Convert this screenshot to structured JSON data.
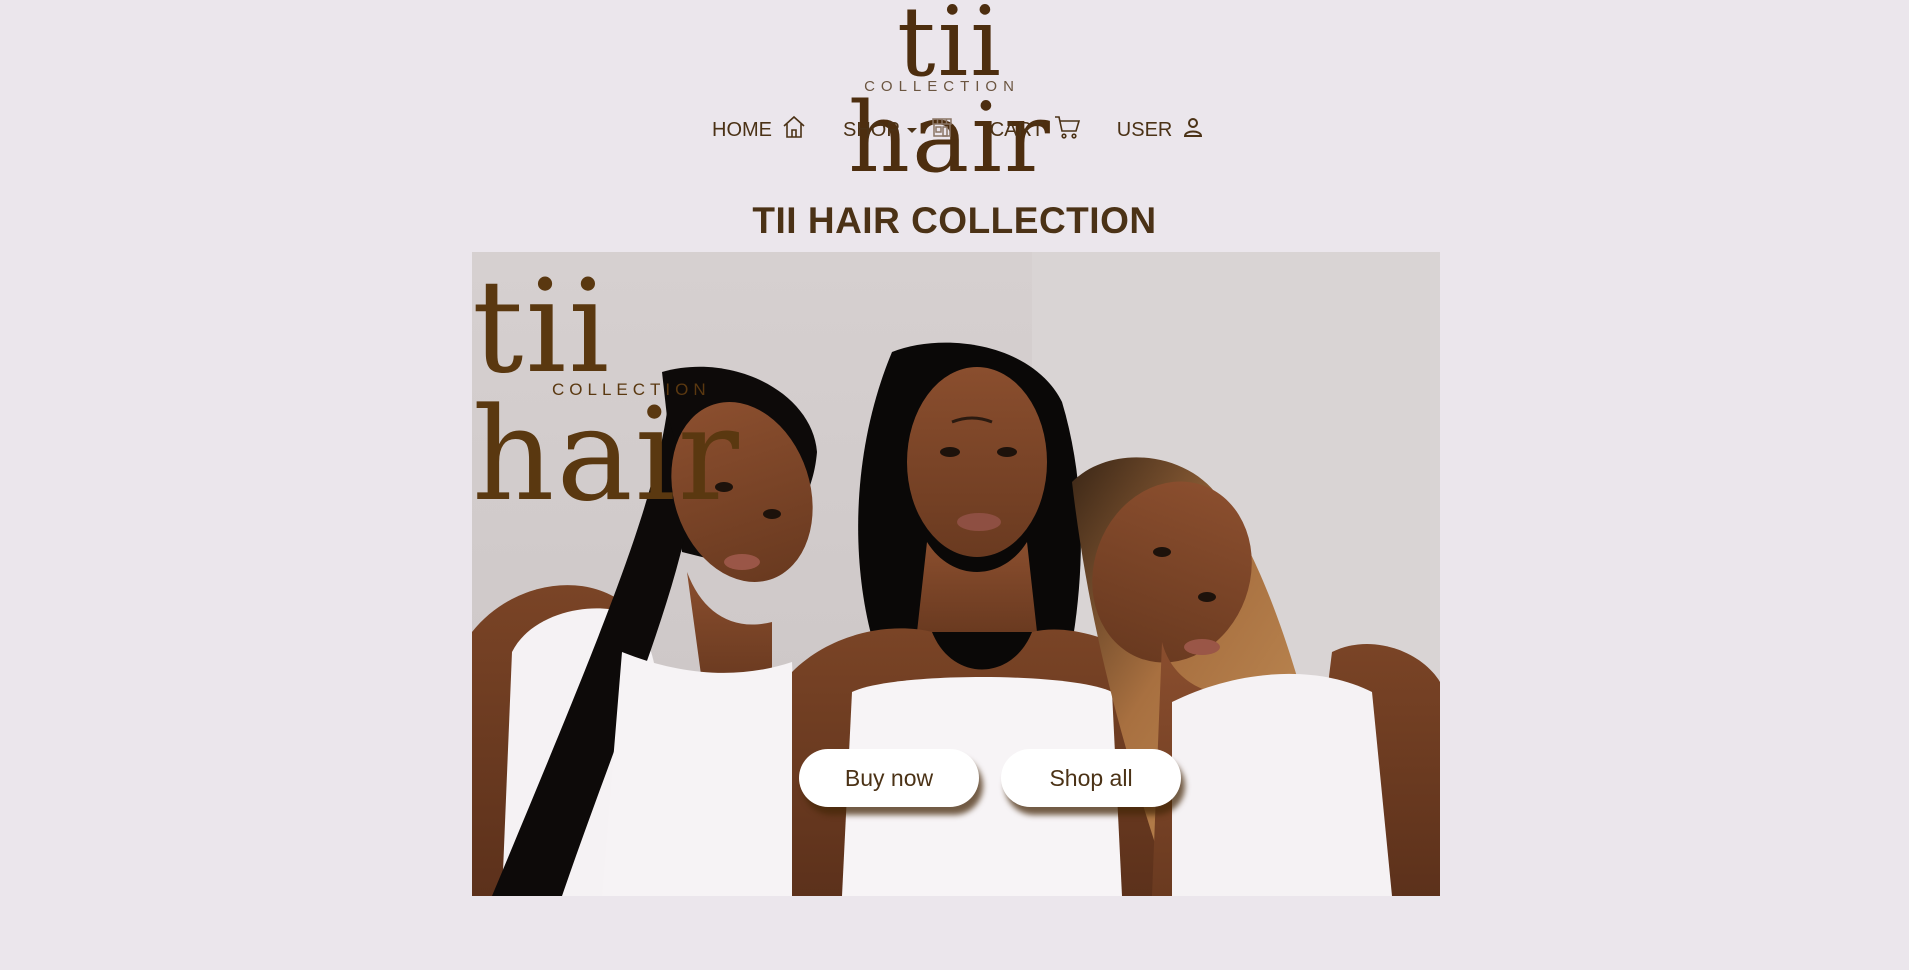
{
  "brand": {
    "logo_main": "tii hair",
    "logo_sub": "COLLECTION"
  },
  "nav": {
    "items": [
      {
        "label": "HOME",
        "icon": "home-icon"
      },
      {
        "label": "SHOP",
        "icon": "store-icon",
        "dropdown": true
      },
      {
        "label": "CART",
        "icon": "cart-icon"
      },
      {
        "label": "USER",
        "icon": "user-icon"
      }
    ]
  },
  "page": {
    "title": "TII HAIR COLLECTION"
  },
  "hero": {
    "logo_main": "tii hair",
    "logo_sub": "COLLECTION",
    "buttons": {
      "buy_label": "Buy now",
      "shop_label": "Shop all"
    }
  },
  "colors": {
    "background": "#ebe6ec",
    "brand_brown": "#4d2e0f",
    "button_bg": "#ffffff"
  }
}
